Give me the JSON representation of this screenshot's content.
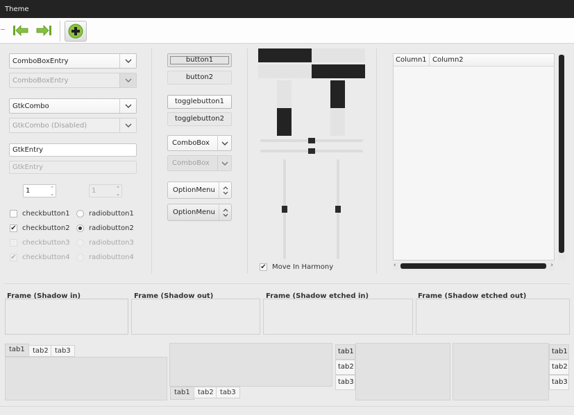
{
  "window": {
    "title": "Theme"
  },
  "toolbar": {
    "back_icon": "go-first-icon",
    "forward_icon": "go-last-icon",
    "add_icon": "add-icon",
    "accent_color": "#7db82e"
  },
  "left": {
    "combo_entry": "ComboBoxEntry",
    "combo_entry_disabled": "ComboBoxEntry",
    "gtk_combo": "GtkCombo",
    "gtk_combo_disabled": "GtkCombo (Disabled)",
    "gtk_entry": "GtkEntry",
    "gtk_entry_disabled": "GtkEntry",
    "spin_value": "1",
    "spin_disabled_value": "1",
    "checks": [
      {
        "label": "checkbutton1",
        "checked": false,
        "disabled": false
      },
      {
        "label": "checkbutton2",
        "checked": true,
        "disabled": false
      },
      {
        "label": "checkbutton3",
        "checked": false,
        "disabled": true
      },
      {
        "label": "checkbutton4",
        "checked": true,
        "disabled": true
      }
    ],
    "radios": [
      {
        "label": "radiobutton1",
        "selected": false,
        "disabled": false
      },
      {
        "label": "radiobutton2",
        "selected": true,
        "disabled": false
      },
      {
        "label": "radiobutton3",
        "selected": false,
        "disabled": true
      },
      {
        "label": "radiobutton4",
        "selected": false,
        "disabled": true
      }
    ]
  },
  "middle": {
    "button1": "button1",
    "button2": "button2",
    "toggle1": "togglebutton1",
    "toggle2": "togglebutton2",
    "combobox": "ComboBox",
    "combobox_disabled": "ComboBox",
    "optionmenu1": "OptionMenu",
    "optionmenu2": "OptionMenu"
  },
  "progress": {
    "h1_fraction": 0.5,
    "h2_fraction": 0.5,
    "v1_fraction": 0.5,
    "v2_fraction": 0.5
  },
  "scales": {
    "move_in_harmony_label": "Move In Harmony",
    "move_in_harmony_checked": true,
    "h1_value": 0.5,
    "h2_value": 0.5,
    "v1_value": 0.5,
    "v2_value": 0.5
  },
  "tree": {
    "columns": [
      "Column1",
      "Column2"
    ]
  },
  "frames": [
    {
      "label": "Frame (Shadow in)"
    },
    {
      "label": "Frame (Shadow out)"
    },
    {
      "label": "Frame (Shadow etched in)"
    },
    {
      "label": "Frame (Shadow etched out)"
    }
  ],
  "tabs": {
    "top": [
      "tab1",
      "tab2",
      "tab3"
    ],
    "bottom": [
      "tab1",
      "tab2",
      "tab3"
    ],
    "left": [
      "tab1",
      "tab2",
      "tab3"
    ],
    "right": [
      "tab1",
      "tab2",
      "tab3"
    ]
  },
  "colors": {
    "progress_fill": "#232323",
    "titlebar": "#232323",
    "background": "#ebebeb"
  }
}
